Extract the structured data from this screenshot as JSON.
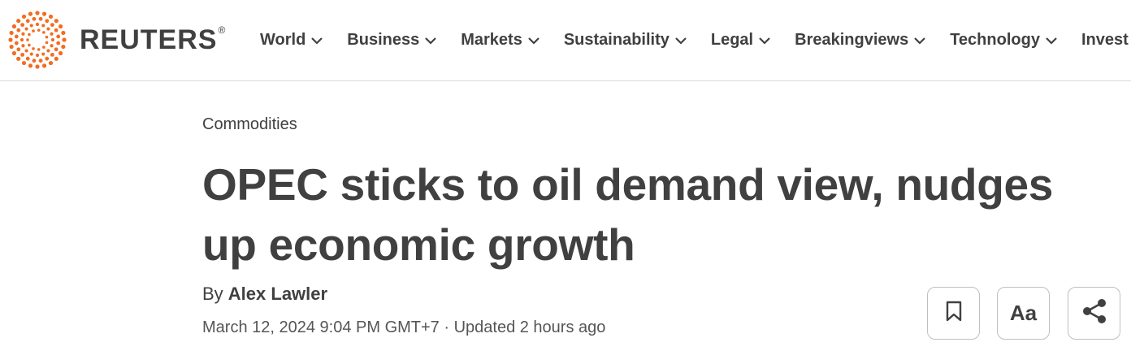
{
  "brand": {
    "name": "REUTERS",
    "registered_mark": "®",
    "accent_color": "#f26c21",
    "logo_icon": "reuters-dot-ring-logo"
  },
  "nav": {
    "items": [
      {
        "label": "World",
        "icon": "chevron-down-icon"
      },
      {
        "label": "Business",
        "icon": "chevron-down-icon"
      },
      {
        "label": "Markets",
        "icon": "chevron-down-icon"
      },
      {
        "label": "Sustainability",
        "icon": "chevron-down-icon"
      },
      {
        "label": "Legal",
        "icon": "chevron-down-icon"
      },
      {
        "label": "Breakingviews",
        "icon": "chevron-down-icon"
      },
      {
        "label": "Technology",
        "icon": "chevron-down-icon"
      },
      {
        "label": "Invest"
      }
    ]
  },
  "article": {
    "category": "Commodities",
    "headline": "OPEC sticks to oil demand view, nudges up economic growth",
    "byline_prefix": "By ",
    "author": "Alex Lawler",
    "dateline": "March 12, 2024 9:04 PM GMT+7 · Updated 2 hours ago"
  },
  "tools": {
    "bookmark_icon": "bookmark-icon",
    "text_size_label": "Aa",
    "share_icon": "share-icon"
  }
}
